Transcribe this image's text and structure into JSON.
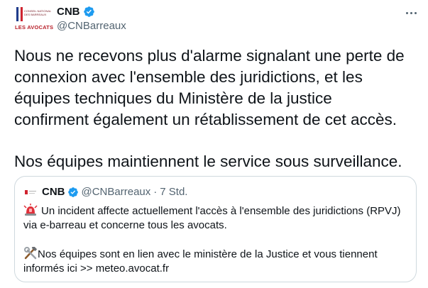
{
  "author": {
    "avatar_text": [
      "CONSEIL NATIONAL",
      "DES BARREAUX"
    ],
    "avatar_brand": "LES AVOCATS",
    "name": "CNB",
    "handle": "@CNBarreaux"
  },
  "tweet_text": {
    "lines": [
      "Nous ne recevons plus d'alarme signalant une perte de",
      "connexion avec l'ensemble des juridictions, et les",
      "équipes techniques du Ministère de la justice",
      "confirment également un rétablissement de cet accès."
    ],
    "last_line": "Nos équipes maintiennent le service sous surveillance."
  },
  "quoted": {
    "name": "CNB",
    "handle": "@CNBarreaux",
    "separator": "·",
    "time": "7 Std.",
    "line1": "Un incident affecte actuellement l'accès à l'ensemble des juridictions (RPVJ)",
    "line2": "via e-barreau et concerne tous les avocats.",
    "line3": "Nos équipes sont en lien avec le ministère de la Justice et vous tiennent",
    "line4": "informés ici >> meteo.avocat.fr",
    "icons": [
      "rotating-light-icon",
      "hammer-and-wrench-icon"
    ]
  },
  "colors": {
    "verified": "#1d9bf0",
    "secondary_text": "#536471",
    "brand_red": "#b8202a"
  }
}
